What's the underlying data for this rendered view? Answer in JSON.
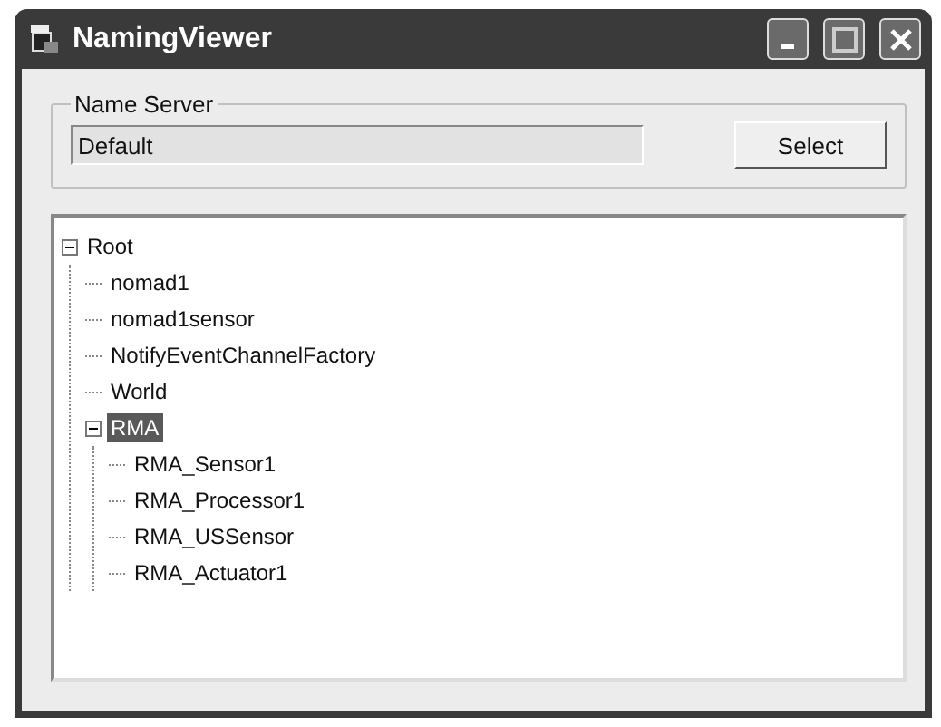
{
  "window": {
    "title": "NamingViewer"
  },
  "name_server": {
    "label": "Name Server",
    "value": "Default",
    "button": "Select"
  },
  "tree": [
    {
      "label": "Root",
      "expanded": true,
      "selected": false,
      "children": [
        {
          "label": "nomad1",
          "selected": false
        },
        {
          "label": "nomad1sensor",
          "selected": false
        },
        {
          "label": "NotifyEventChannelFactory",
          "selected": false
        },
        {
          "label": "World",
          "selected": false
        },
        {
          "label": "RMA",
          "expanded": true,
          "selected": true,
          "children": [
            {
              "label": "RMA_Sensor1",
              "selected": false
            },
            {
              "label": "RMA_Processor1",
              "selected": false
            },
            {
              "label": "RMA_USSensor",
              "selected": false
            },
            {
              "label": "RMA_Actuator1",
              "selected": false
            }
          ]
        }
      ]
    }
  ]
}
